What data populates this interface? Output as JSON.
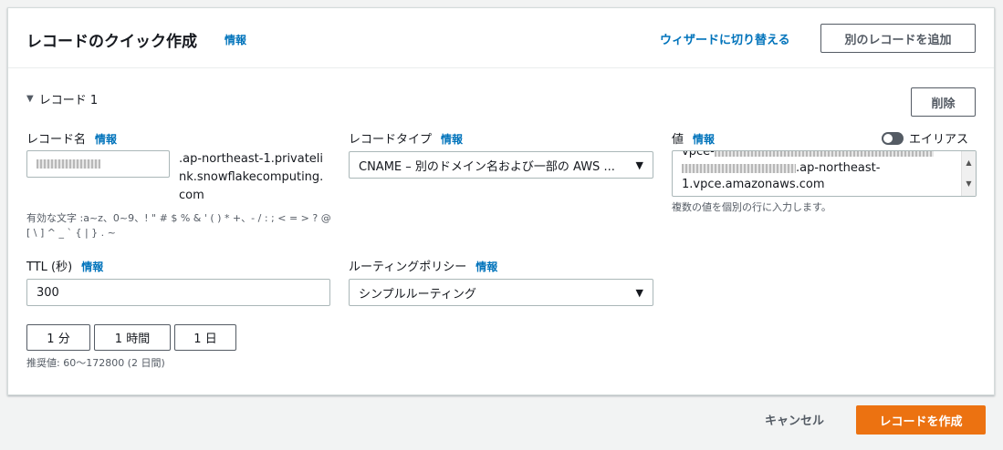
{
  "header": {
    "title": "レコードのクイック作成",
    "info": "情報",
    "wizard_link": "ウィザードに切り替える",
    "add_record_button": "別のレコードを追加"
  },
  "record": {
    "section_label": "レコード 1",
    "delete_button": "削除",
    "name": {
      "label": "レコード名",
      "info": "情報",
      "suffix": ".ap-northeast-1.privatelink.snowflakecomputing.com",
      "hint": "有効な文字 :a~z、0~9、! \" # $ % & ' ( ) * +、- / : ; < = > ? @ [ \\ ] ^ _ ` { | } . ~"
    },
    "type": {
      "label": "レコードタイプ",
      "info": "情報",
      "selected": "CNAME – 別のドメイン名および一部の AWS ..."
    },
    "value": {
      "label": "値",
      "info": "情報",
      "alias_label": "エイリアス",
      "line1_prefix": "vpce-",
      "line2_suffix": ".ap-northeast-",
      "line3": "1.vpce.amazonaws.com",
      "hint": "複数の値を個別の行に入力します。"
    },
    "ttl": {
      "label": "TTL (秒)",
      "info": "情報",
      "value": "300",
      "btn_1min": "1 分",
      "btn_1hour": "1 時間",
      "btn_1day": "1 日",
      "hint": "推奨値: 60〜172800 (2 日間)"
    },
    "routing": {
      "label": "ルーティングポリシー",
      "info": "情報",
      "selected": "シンプルルーティング"
    }
  },
  "footer": {
    "cancel": "キャンセル",
    "create": "レコードを作成"
  },
  "colors": {
    "link": "#0073bb",
    "primary": "#ec7211",
    "background": "#f2f3f3"
  }
}
